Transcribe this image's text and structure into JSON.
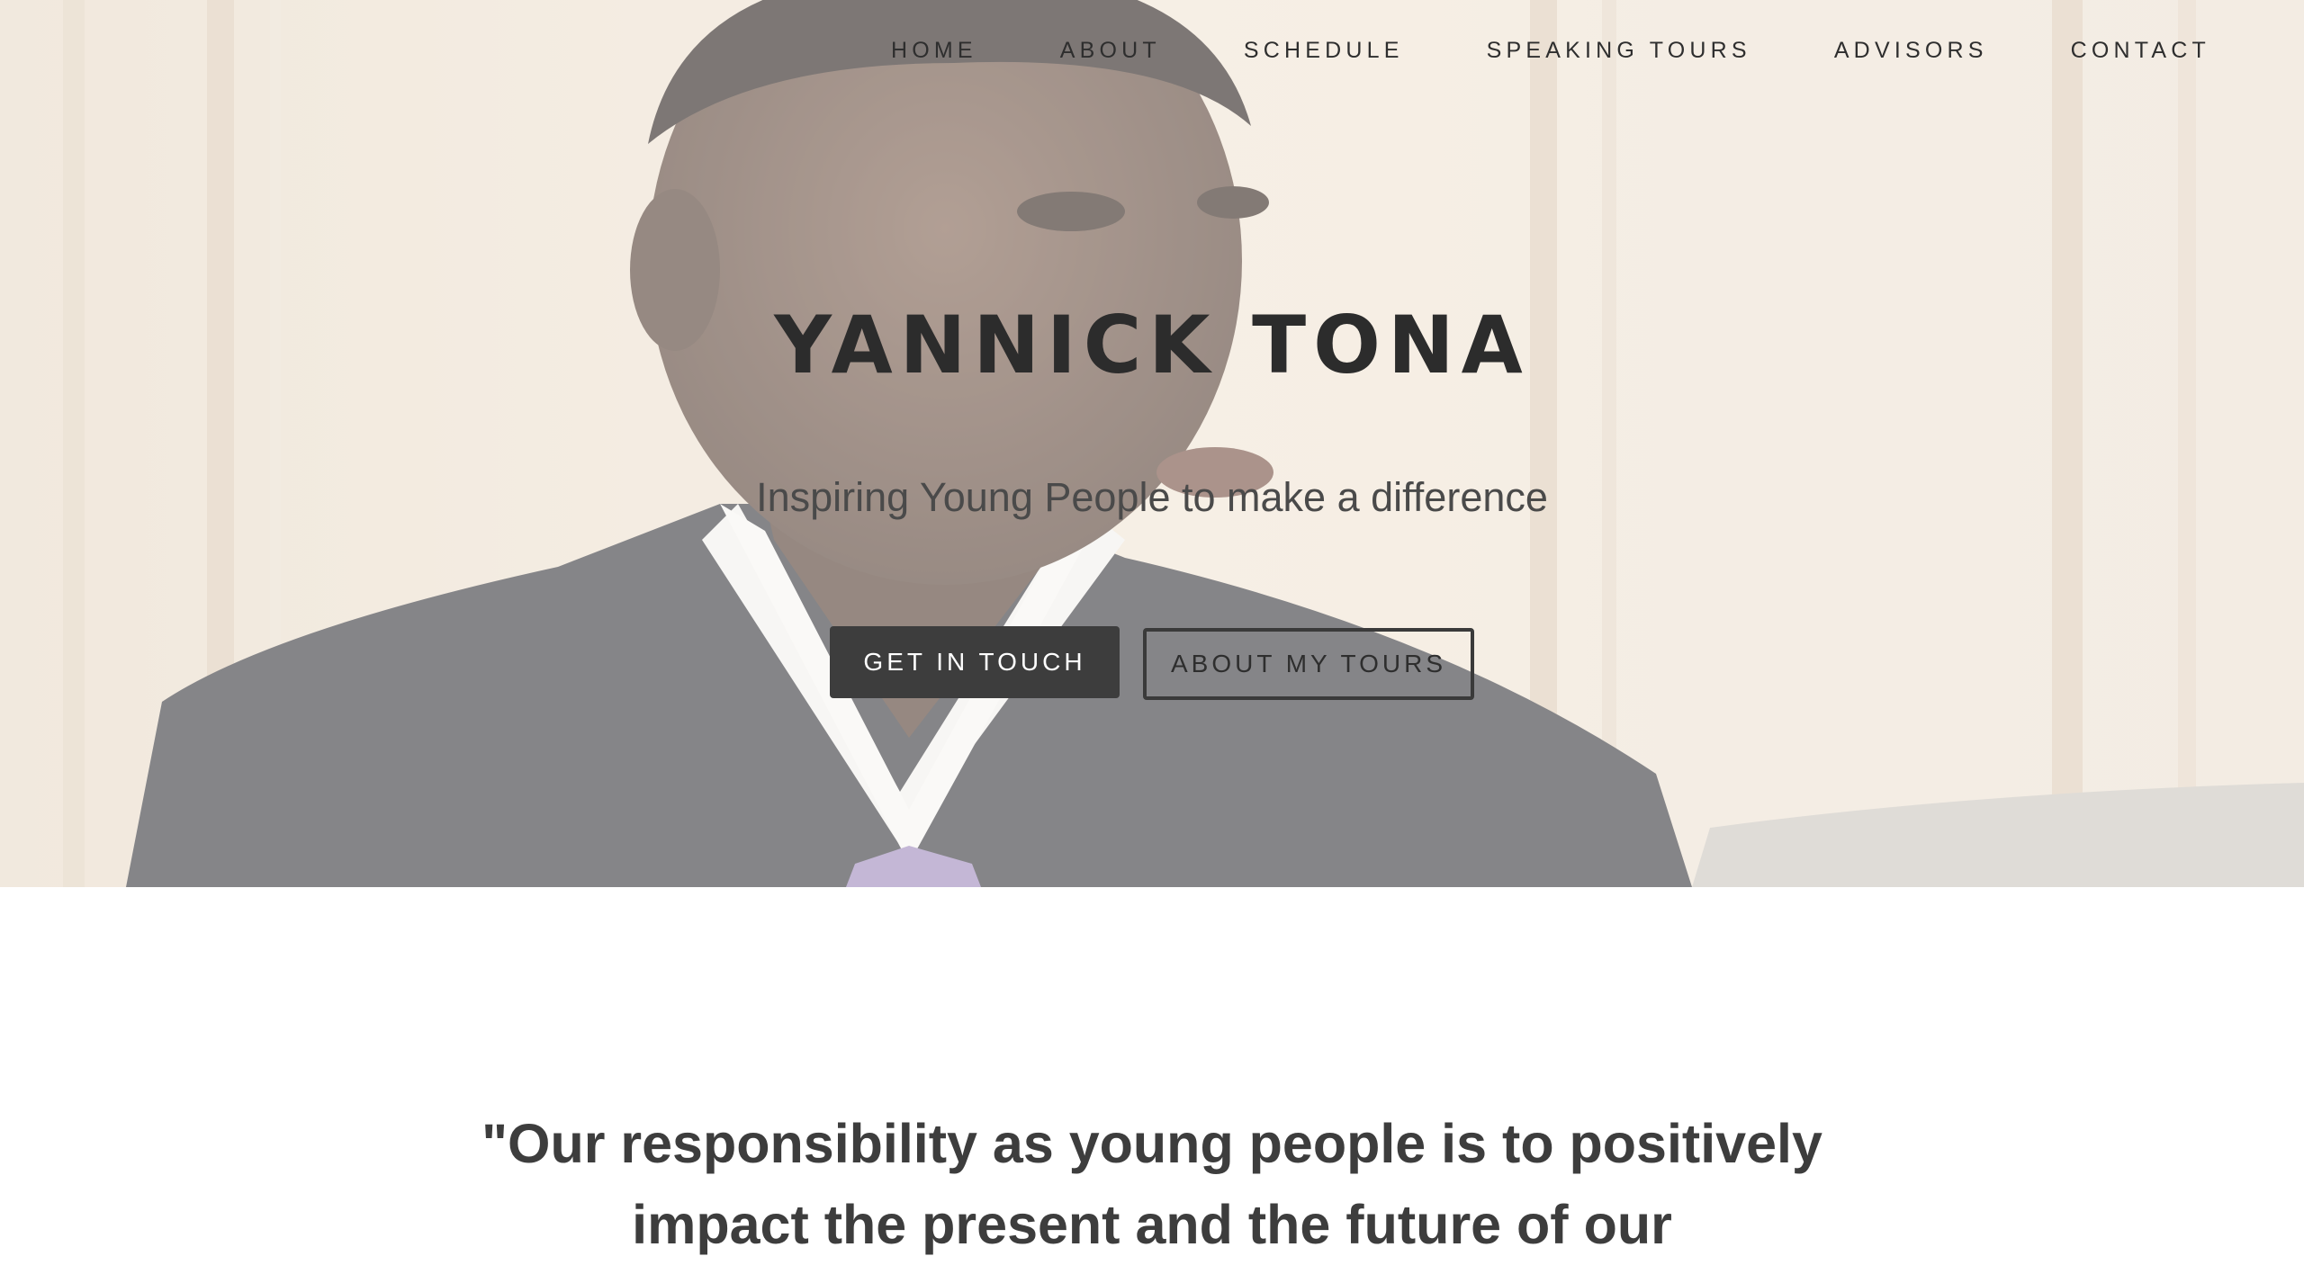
{
  "nav": {
    "items": [
      {
        "label": "HOME"
      },
      {
        "label": "ABOUT"
      },
      {
        "label": "SCHEDULE"
      },
      {
        "label": "SPEAKING TOURS"
      },
      {
        "label": "ADVISORS"
      },
      {
        "label": "CONTACT"
      }
    ]
  },
  "hero": {
    "title": "YANNICK TONA",
    "subtitle": "Inspiring Young People to make a difference",
    "primary_button": "GET IN TOUCH",
    "secondary_button": "ABOUT MY TOURS"
  },
  "quote": {
    "text": "\"Our responsibility as young people is to positively impact the present and the future of our"
  },
  "colors": {
    "hero_tint": "#ede6dc",
    "primary_button_bg": "#3d3d3d",
    "text_dark": "#2c2c2c",
    "quote_text": "#3d3d3d"
  }
}
